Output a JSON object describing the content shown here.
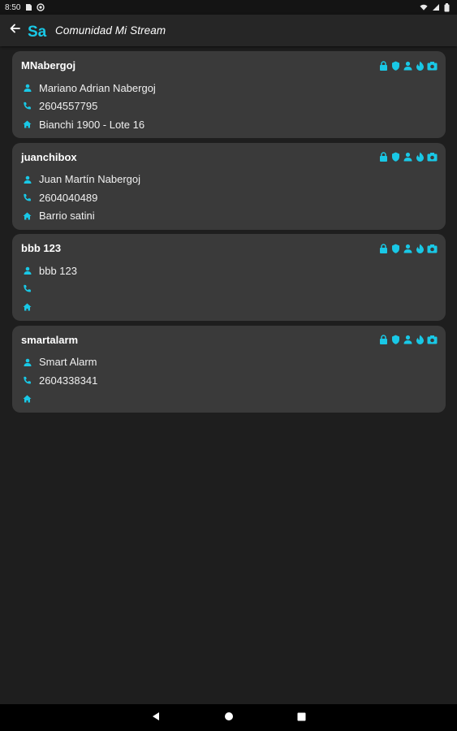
{
  "status_bar": {
    "time": "8:50",
    "left_icons": [
      "sd-card-icon",
      "at-sign-icon"
    ],
    "right_icons": [
      "wifi-icon",
      "signal-icon",
      "battery-icon"
    ]
  },
  "app_bar": {
    "back_icon": "arrow-back-icon",
    "logo_text": "Sa",
    "title": "Comunidad Mi Stream"
  },
  "colors": {
    "accent": "#19c8e6",
    "card_bg": "#3a3a3a",
    "page_bg": "#1e1e1e"
  },
  "card_icons": [
    "lock-icon",
    "shield-icon",
    "person-alert-icon",
    "fire-icon",
    "camera-icon"
  ],
  "cards": [
    {
      "username": "MNabergoj",
      "name": "Mariano Adrian Nabergoj",
      "phone": "2604557795",
      "address": "Bianchi 1900 - Lote 16"
    },
    {
      "username": "juanchibox",
      "name": "Juan Martín Nabergoj",
      "phone": "2604040489",
      "address": "Barrio satini"
    },
    {
      "username": "bbb 123",
      "name": "bbb 123",
      "phone": "",
      "address": ""
    },
    {
      "username": "smartalarm",
      "name": "Smart Alarm",
      "phone": "2604338341",
      "address": ""
    }
  ],
  "nav_bar": {
    "buttons": [
      "back-triangle-icon",
      "home-circle-icon",
      "recents-square-icon"
    ]
  }
}
